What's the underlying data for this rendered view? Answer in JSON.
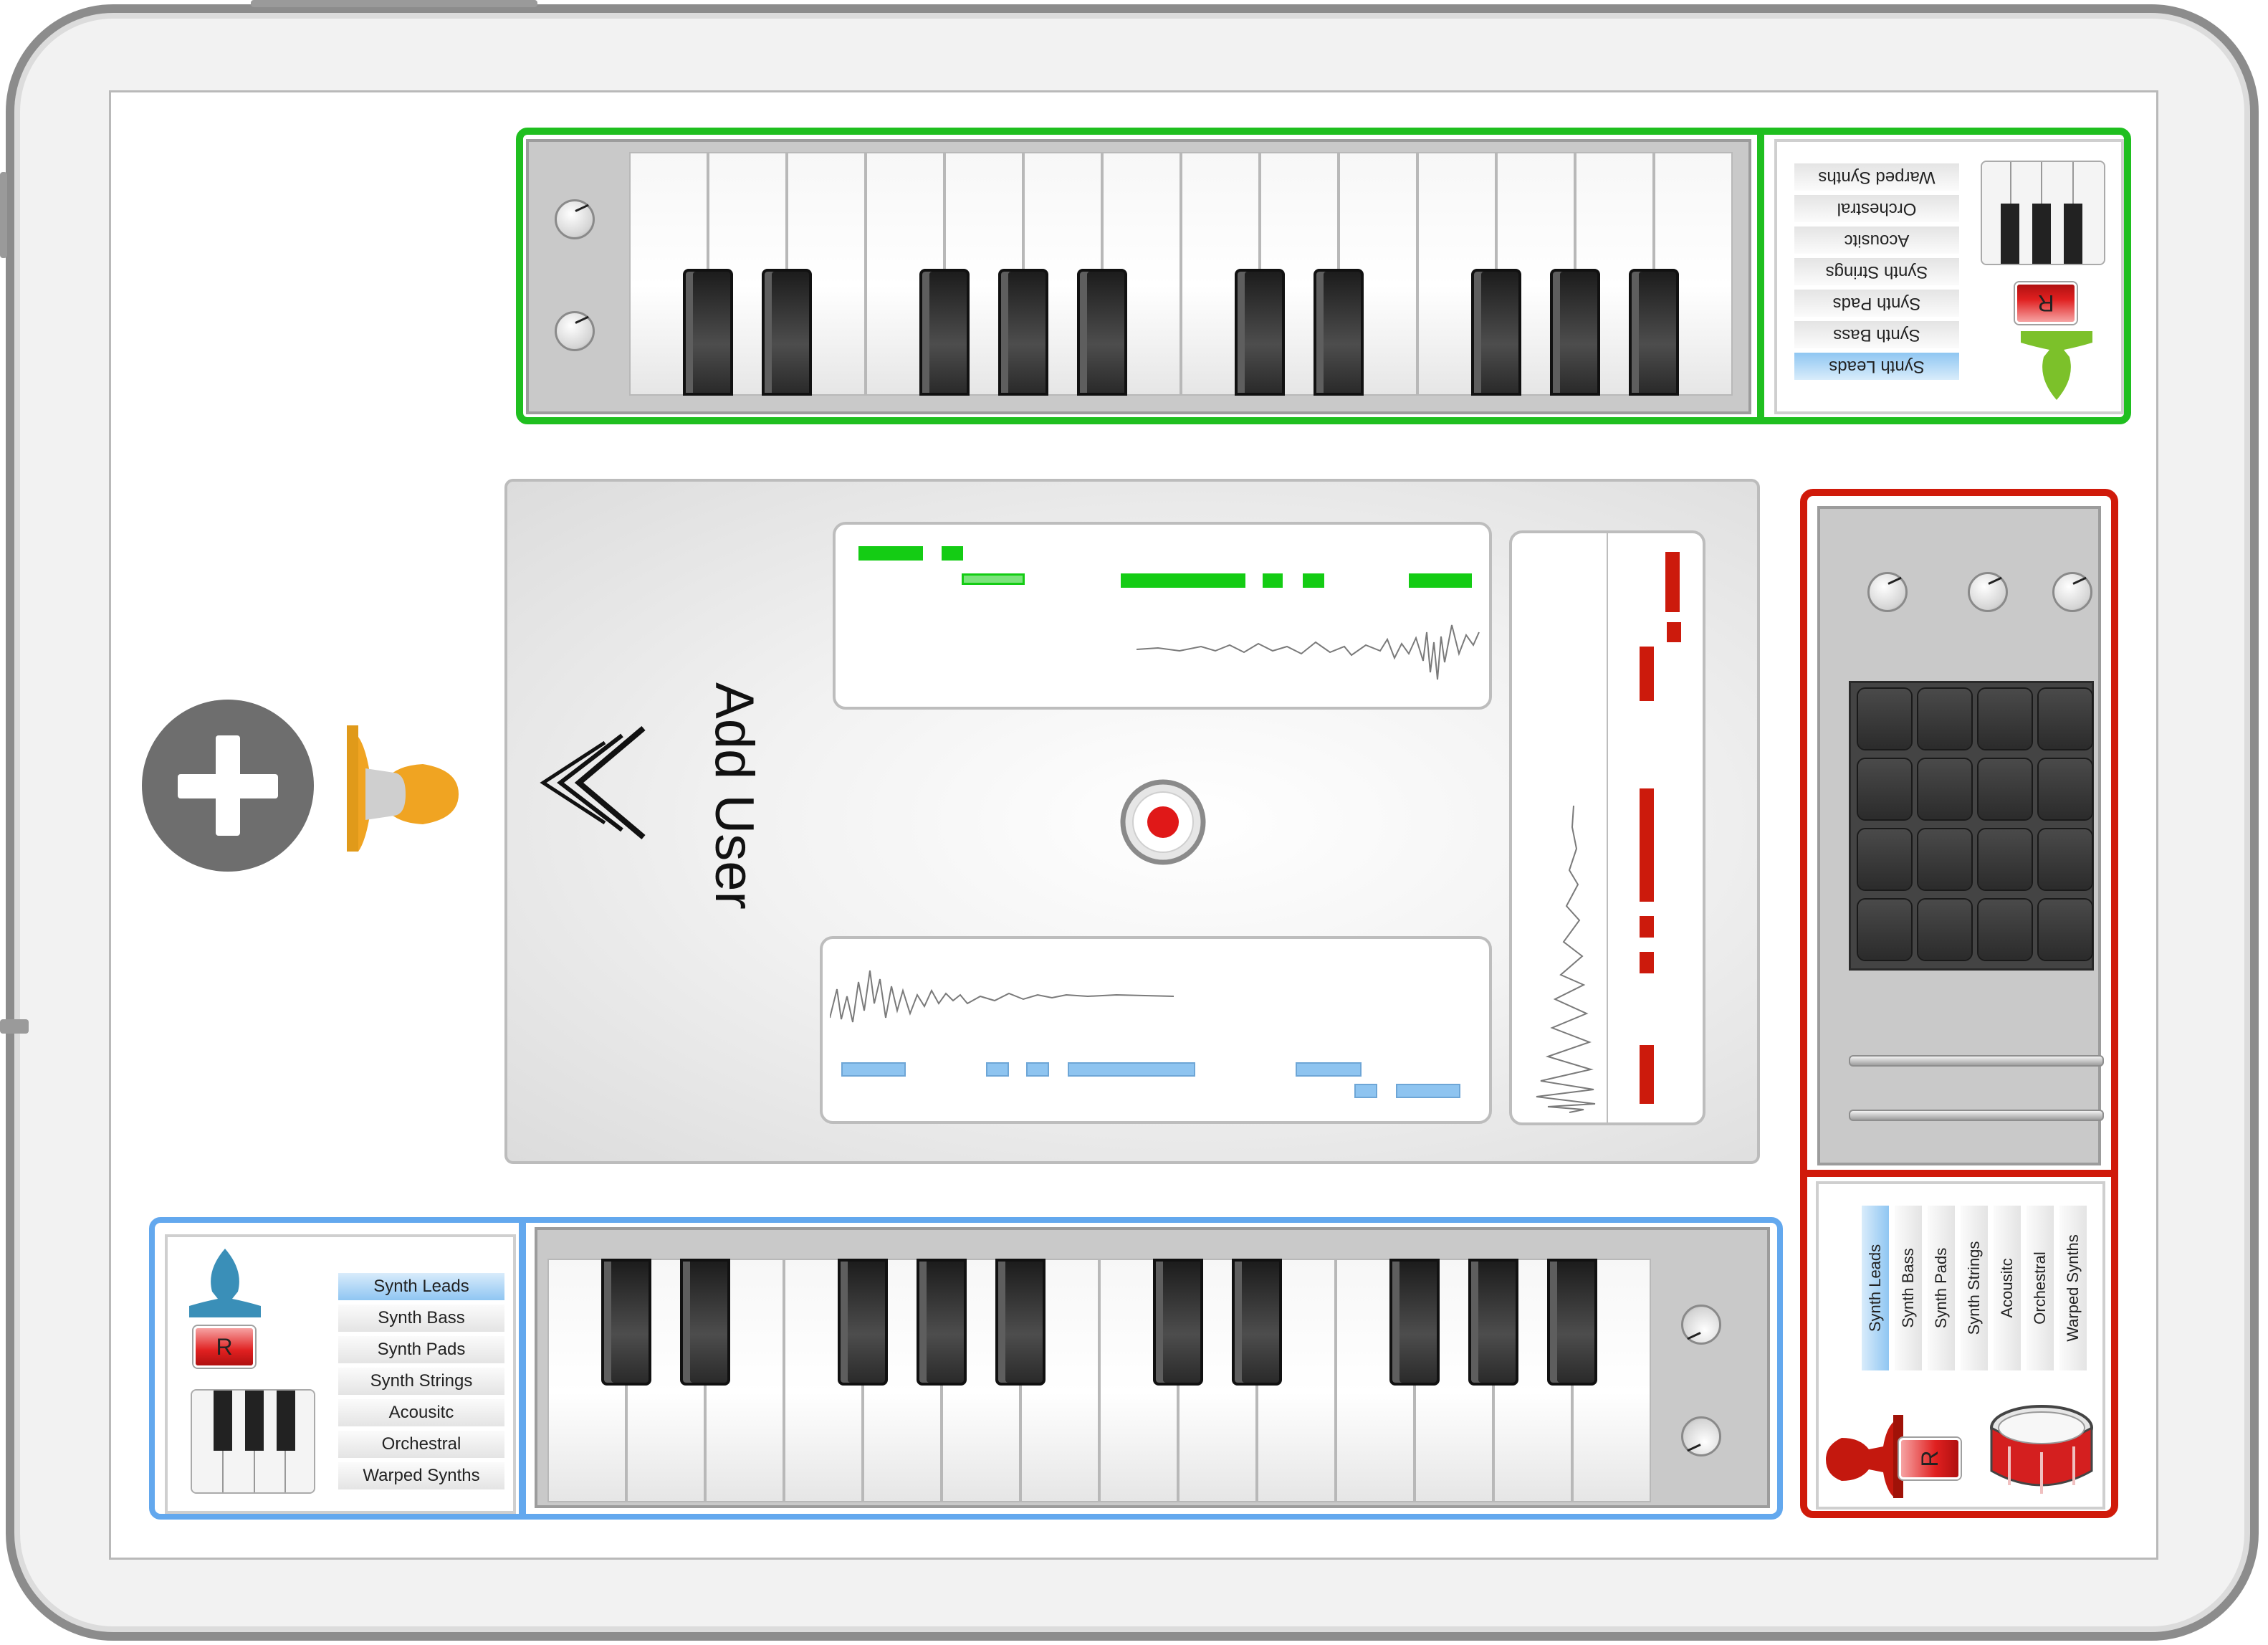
{
  "instruments": [
    "Synth Leads",
    "Synth Bass",
    "Synth Pads",
    "Synth Strings",
    "Acousitc",
    "Orchestral",
    "Warped Synths"
  ],
  "green_instruments": [
    "Warped Synths",
    "Orchestral",
    "Acousitc",
    "Synth Strings",
    "Synth Pads",
    "Synth Bass",
    "Synth Leads"
  ],
  "red_instruments": [
    "Synth Leads",
    "Synth Bass",
    "Synth Pads",
    "Synth Strings",
    "Acousitc",
    "Orchestral",
    "Warped Synths"
  ],
  "record_label": "R",
  "add_user_label": "Add User",
  "colors": {
    "green_accent": "#1fbf1f",
    "blue_accent": "#63a8ee",
    "red_accent": "#d01a0a",
    "user_orange": "#f0a422",
    "user_green": "#7cc12a",
    "user_blue": "#3a8fb8",
    "user_red": "#c4180e"
  },
  "icons": [
    "plus-icon",
    "user-icon",
    "chevron-left-double-icon",
    "record-icon",
    "piano-icon",
    "drum-icon"
  ]
}
